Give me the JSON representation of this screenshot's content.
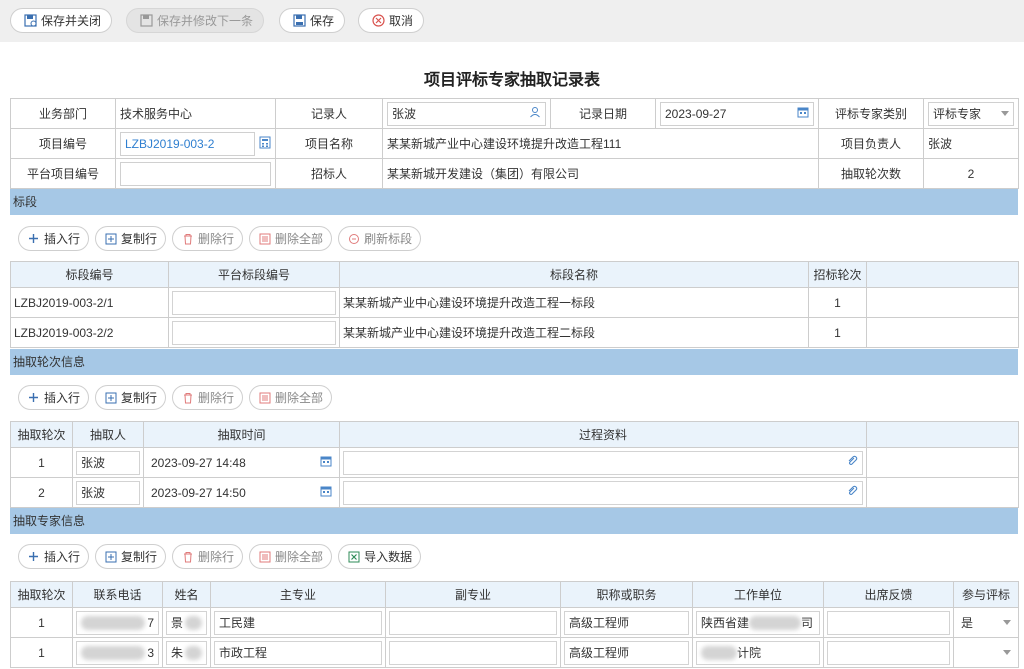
{
  "toolbar": {
    "save_close": "保存并关闭",
    "save_next": "保存并修改下一条",
    "save": "保存",
    "cancel": "取消"
  },
  "title": "项目评标专家抽取记录表",
  "form": {
    "dept_label": "业务部门",
    "dept_value": "技术服务中心",
    "recorder_label": "记录人",
    "recorder_value": "张波",
    "record_date_label": "记录日期",
    "record_date_value": "2023-09-27",
    "expert_type_label": "评标专家类别",
    "expert_type_value": "评标专家",
    "project_no_label": "项目编号",
    "project_no_value": "LZBJ2019-003-2",
    "project_name_label": "项目名称",
    "project_name_value": "某某新城产业中心建设环境提升改造工程111",
    "manager_label": "项目负责人",
    "manager_value": "张波",
    "platform_no_label": "平台项目编号",
    "platform_no_value": "",
    "tenderer_label": "招标人",
    "tenderer_value": "某某新城开发建设（集团）有限公司",
    "rounds_label": "抽取轮次数",
    "rounds_value": "2"
  },
  "sections": {
    "lots": "标段",
    "rounds": "抽取轮次信息",
    "experts": "抽取专家信息"
  },
  "buttons": {
    "insert": "插入行",
    "copy": "复制行",
    "delete": "删除行",
    "delete_all": "删除全部",
    "refresh_lots": "刷新标段",
    "import": "导入数据"
  },
  "lots_table": {
    "headers": [
      "标段编号",
      "平台标段编号",
      "标段名称",
      "招标轮次"
    ],
    "rows": [
      {
        "no": "LZBJ2019-003-2/1",
        "platform": "",
        "name": "某某新城产业中心建设环境提升改造工程一标段",
        "round": "1"
      },
      {
        "no": "LZBJ2019-003-2/2",
        "platform": "",
        "name": "某某新城产业中心建设环境提升改造工程二标段",
        "round": "1"
      }
    ]
  },
  "rounds_table": {
    "headers": [
      "抽取轮次",
      "抽取人",
      "抽取时间",
      "过程资料"
    ],
    "rows": [
      {
        "round": "1",
        "person": "张波",
        "time": "2023-09-27 14:48",
        "material": ""
      },
      {
        "round": "2",
        "person": "张波",
        "time": "2023-09-27 14:50",
        "material": ""
      }
    ]
  },
  "experts_table": {
    "headers": [
      "抽取轮次",
      "联系电话",
      "姓名",
      "主专业",
      "副专业",
      "职称或职务",
      "工作单位",
      "出席反馈",
      "参与评标"
    ],
    "rows": [
      {
        "round": "1",
        "phone_tail": "7",
        "name": "景",
        "major": "工民建",
        "minor": "",
        "title": "高级工程师",
        "unit_head": "陕西省建",
        "unit_tail": "司",
        "feedback": "",
        "participate": "是"
      },
      {
        "round": "1",
        "phone_tail": "3",
        "name": "朱",
        "major": "市政工程",
        "minor": "",
        "title": "高级工程师",
        "unit_head": "",
        "unit_tail": "计院",
        "feedback": "",
        "participate": ""
      }
    ]
  },
  "colors": {
    "section_bar": "#a6c8e6",
    "header_bg": "#eaf3fb",
    "link_blue": "#2f7fd0"
  }
}
